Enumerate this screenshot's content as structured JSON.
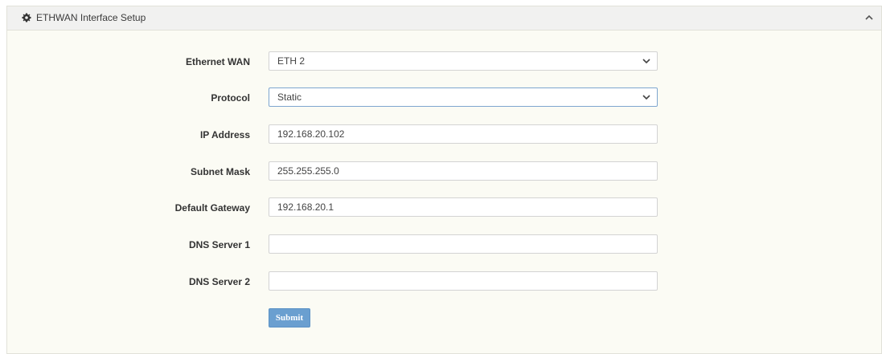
{
  "panel": {
    "title": "ETHWAN Interface Setup",
    "header_icon": "gear-icon",
    "collapse_icon": "chevron-up-icon"
  },
  "form": {
    "ethernet_wan": {
      "label": "Ethernet WAN",
      "value": "ETH 2"
    },
    "protocol": {
      "label": "Protocol",
      "value": "Static"
    },
    "ip_address": {
      "label": "IP Address",
      "value": "192.168.20.102"
    },
    "subnet_mask": {
      "label": "Subnet Mask",
      "value": "255.255.255.0"
    },
    "default_gateway": {
      "label": "Default Gateway",
      "value": "192.168.20.1"
    },
    "dns_server_1": {
      "label": "DNS Server 1",
      "value": ""
    },
    "dns_server_2": {
      "label": "DNS Server 2",
      "value": ""
    },
    "submit_label": "Submit"
  },
  "colors": {
    "panel_background": "#fbfbf4",
    "header_background": "#f1f1f0",
    "submit_button": "#6a9fd0",
    "focused_border": "#7ea6cf"
  }
}
